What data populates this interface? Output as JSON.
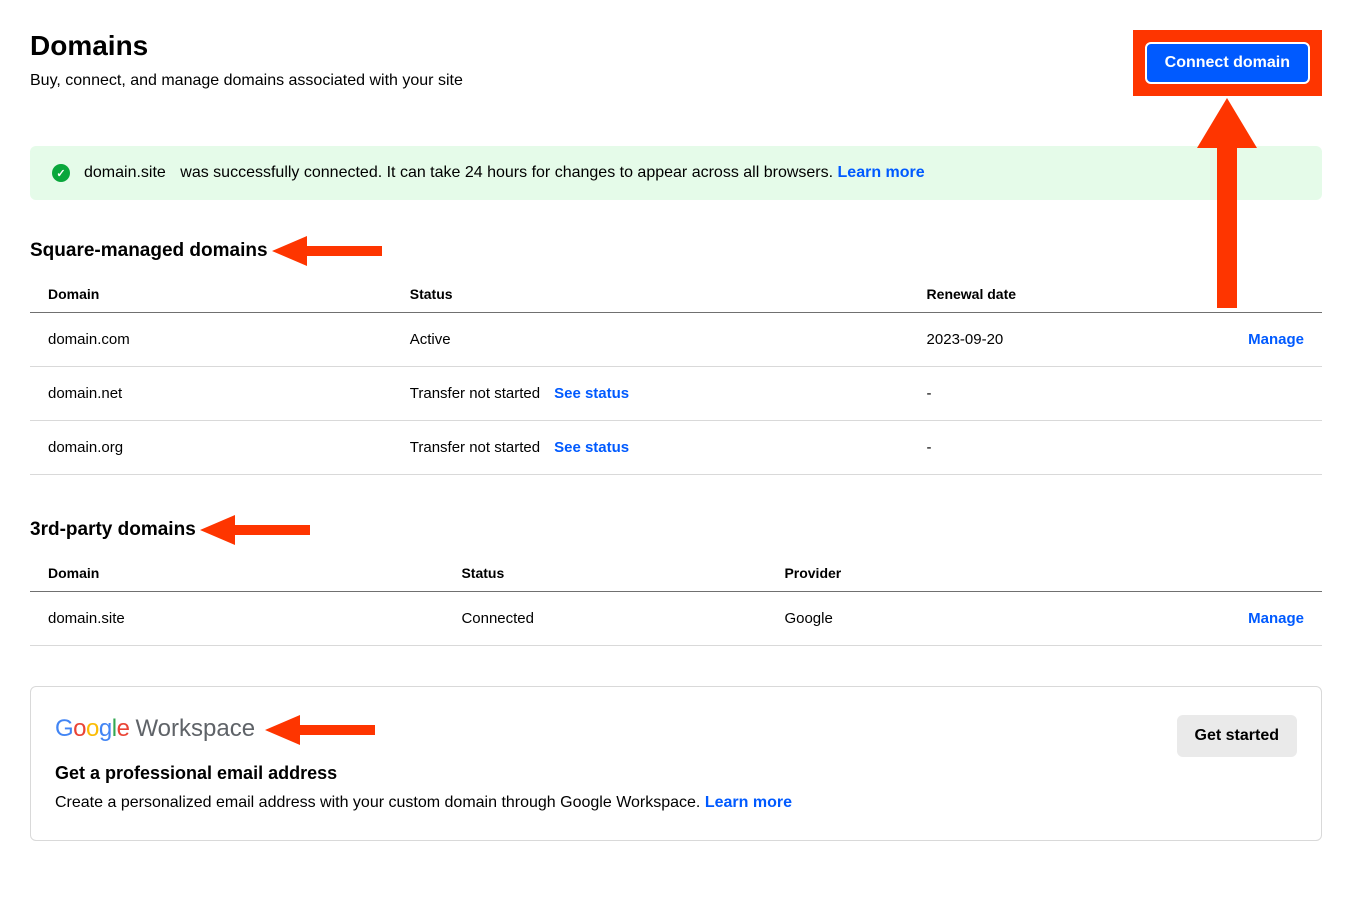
{
  "header": {
    "title": "Domains",
    "subtitle": "Buy, connect, and manage domains associated with your site",
    "connect_button": "Connect domain"
  },
  "alert": {
    "domain": "domain.site",
    "message": "was successfully connected. It can take 24 hours for changes to appear across all browsers.",
    "learn_more": "Learn more"
  },
  "square_section": {
    "heading": "Square-managed domains",
    "columns": {
      "domain": "Domain",
      "status": "Status",
      "renewal": "Renewal date"
    },
    "rows": [
      {
        "domain": "domain.com",
        "status": "Active",
        "see_status": "",
        "renewal": "2023-09-20",
        "action": "Manage"
      },
      {
        "domain": "domain.net",
        "status": "Transfer not started",
        "see_status": "See status",
        "renewal": "-",
        "action": ""
      },
      {
        "domain": "domain.org",
        "status": "Transfer not started",
        "see_status": "See status",
        "renewal": "-",
        "action": ""
      }
    ]
  },
  "third_party_section": {
    "heading": "3rd-party domains",
    "columns": {
      "domain": "Domain",
      "status": "Status",
      "provider": "Provider"
    },
    "rows": [
      {
        "domain": "domain.site",
        "status": "Connected",
        "provider": "Google",
        "action": "Manage"
      }
    ]
  },
  "workspace_card": {
    "logo_google": "Google",
    "logo_workspace": "Workspace",
    "title": "Get a professional email address",
    "description": "Create a personalized email address with your custom domain through Google Workspace.",
    "learn_more": "Learn more",
    "button": "Get started"
  }
}
